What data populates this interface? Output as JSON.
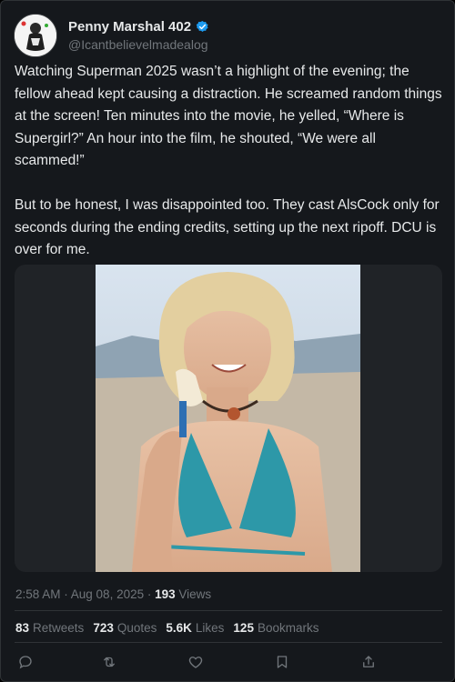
{
  "post": {
    "display_name": "Penny Marshal 402",
    "handle": "@Icantbelievelmadealog",
    "text": "Watching Superman 2025 wasn’t a highlight of the evening; the fellow ahead kept causing a distraction. He screamed random things at the screen! Ten minutes into the movie, he yelled, “Where is Supergirl?” An hour into the film, he shouted, “We were all scammed!”\n\nBut to be honest, I was disappointed too. They cast AlsCock only for seconds during the ending credits, setting up the next ripoff. DCU is over for me.",
    "timestamp": "2:58 AM · Aug 08, 2025",
    "separator": " · ",
    "views_count": "193",
    "views_label": "Views"
  },
  "stats": [
    {
      "count": "83",
      "label": "Retweets"
    },
    {
      "count": "723",
      "label": "Quotes"
    },
    {
      "count": "5.6K",
      "label": "Likes"
    },
    {
      "count": "125",
      "label": "Bookmarks"
    }
  ],
  "icons": {
    "verified": "verified-badge-icon",
    "reply": "reply-icon",
    "retweet": "retweet-icon",
    "like": "heart-icon",
    "bookmark": "bookmark-icon",
    "share": "share-icon"
  },
  "colors": {
    "background": "#15181c",
    "text": "#e7e9ea",
    "muted": "#71767b",
    "verified": "#1d9bf0",
    "border": "#2f3336"
  }
}
